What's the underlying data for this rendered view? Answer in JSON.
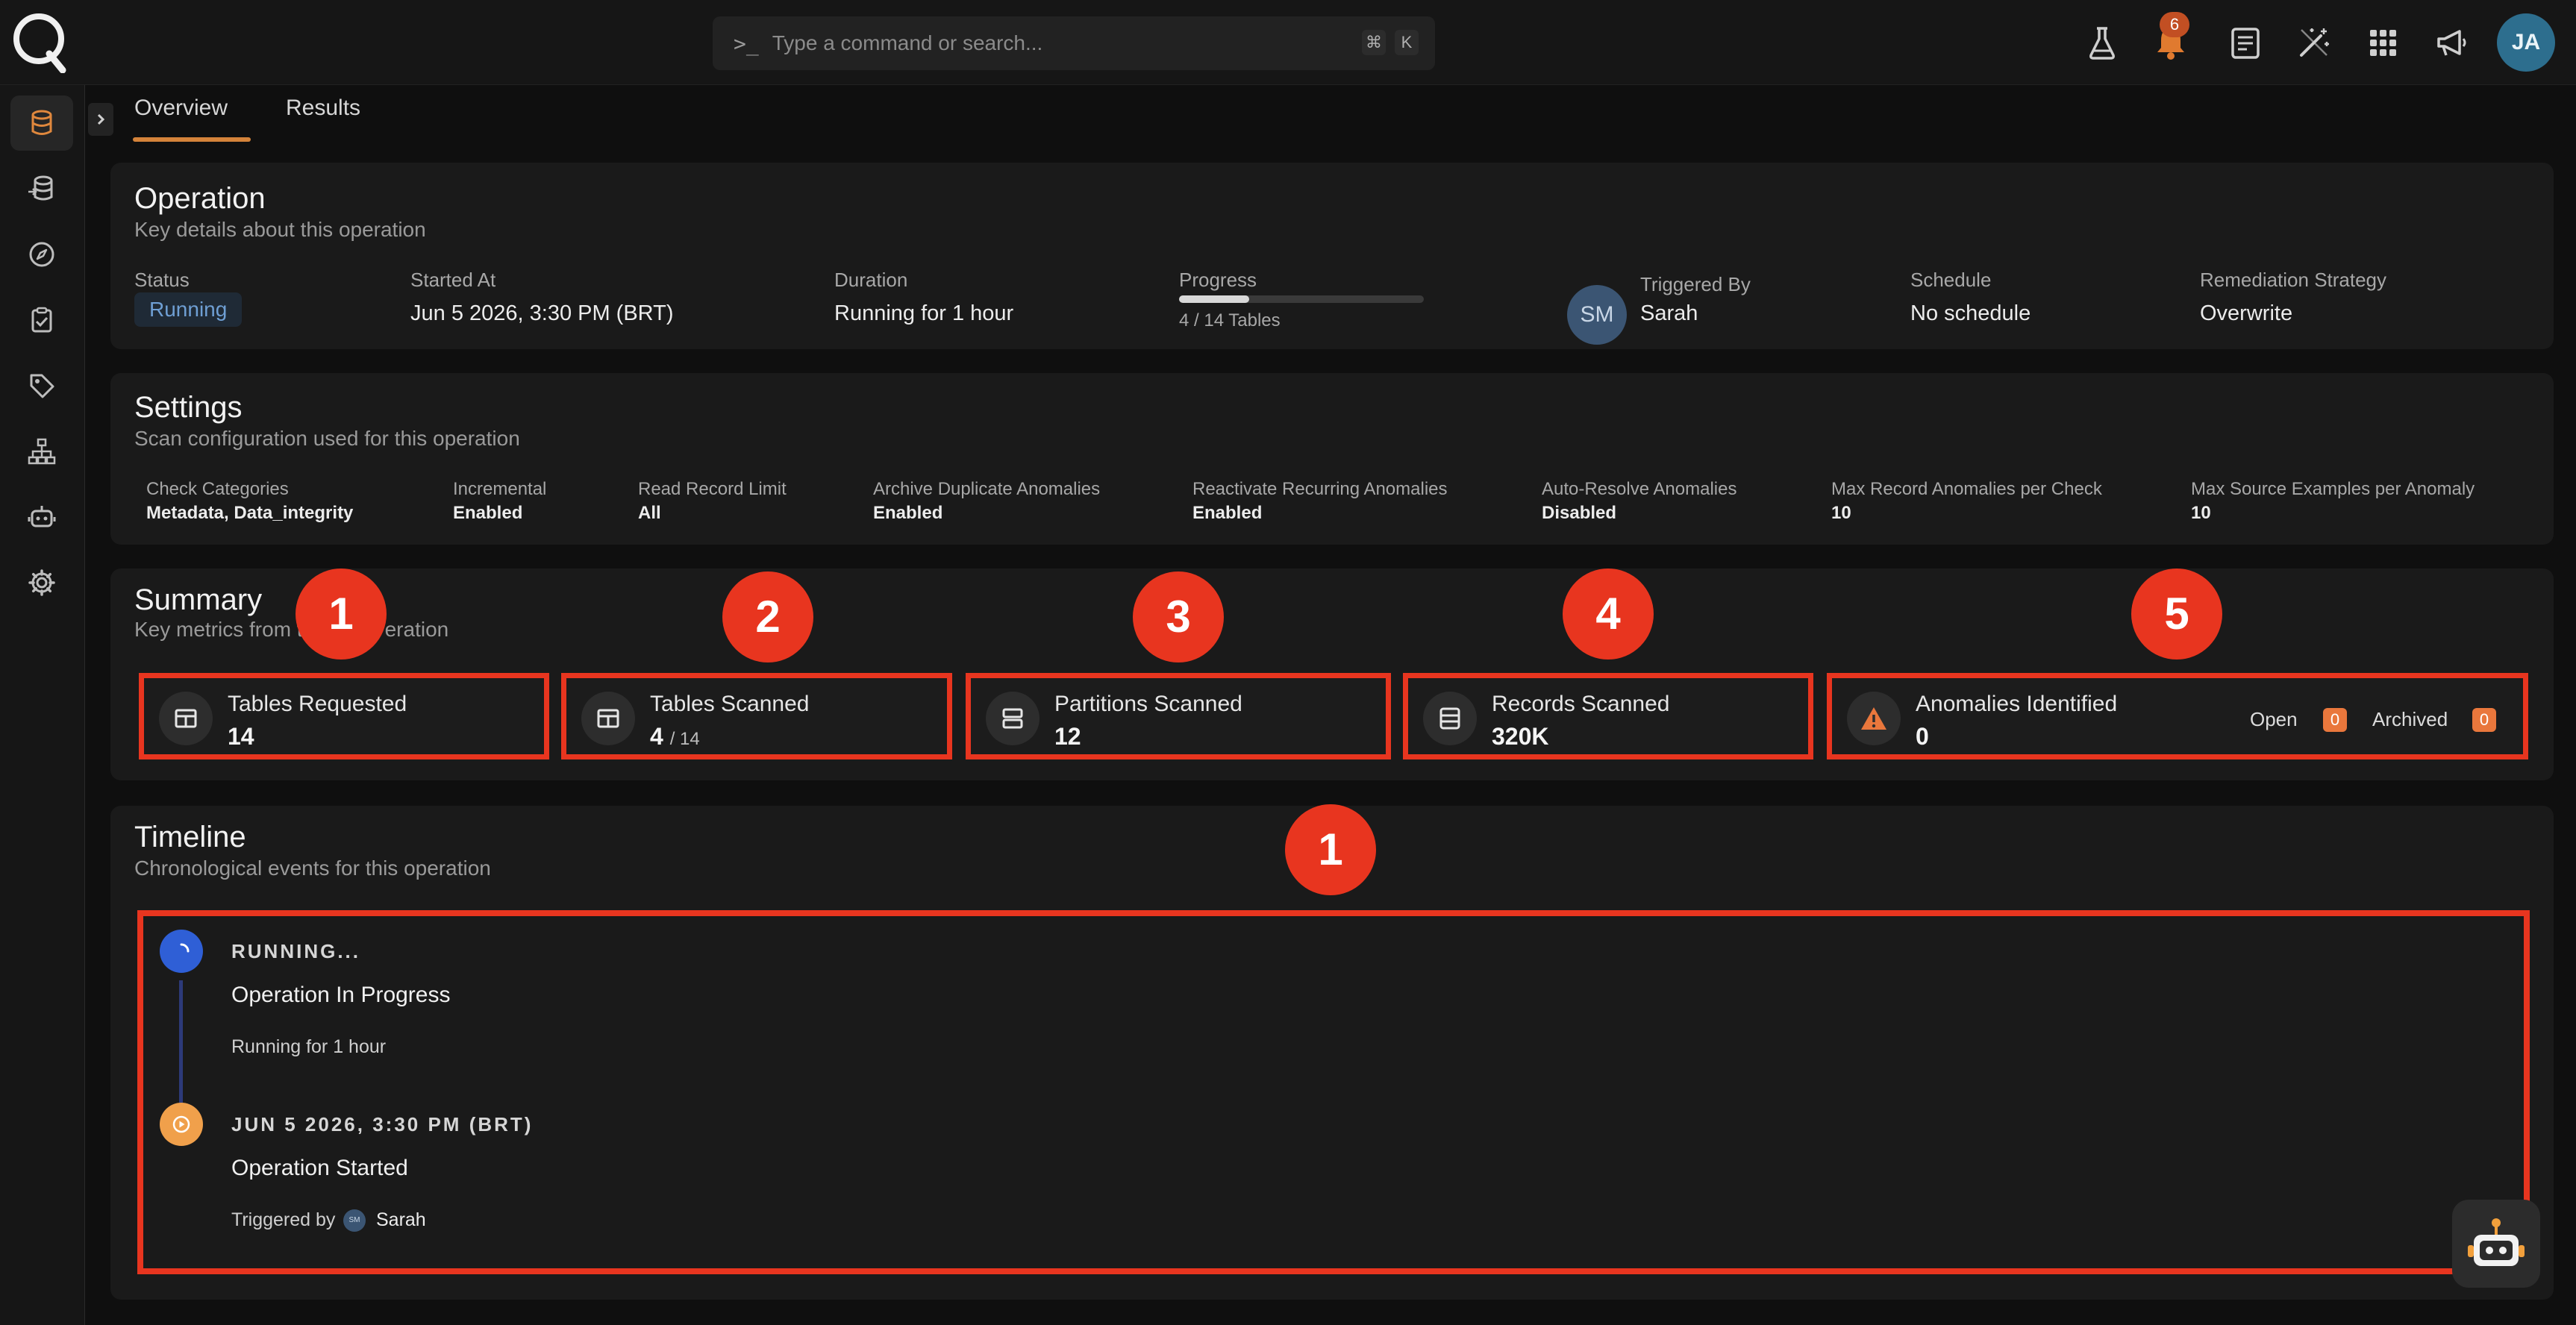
{
  "header": {
    "search_prompt": ">_",
    "search_placeholder": "Type a command or search...",
    "shortcut_key1": "⌘",
    "shortcut_key2": "K",
    "notification_count": "6",
    "user_initials": "JA"
  },
  "tabs": [
    {
      "label": "Overview",
      "active": true
    },
    {
      "label": "Results",
      "active": false
    }
  ],
  "operation": {
    "title": "Operation",
    "subtitle": "Key details about this operation",
    "status_label": "Status",
    "status_value": "Running",
    "started_label": "Started At",
    "started_value": "Jun 5 2026, 3:30 PM (BRT)",
    "duration_label": "Duration",
    "duration_value": "Running for 1 hour",
    "progress_label": "Progress",
    "progress_text": "4 / 14 Tables",
    "progress_fraction": 0.2857,
    "triggered_initials": "SM",
    "triggered_label": "Triggered By",
    "triggered_value": "Sarah",
    "schedule_label": "Schedule",
    "schedule_value": "No schedule",
    "remediation_label": "Remediation Strategy",
    "remediation_value": "Overwrite"
  },
  "settings": {
    "title": "Settings",
    "subtitle": "Scan configuration used for this operation",
    "items": [
      {
        "label": "Check Categories",
        "value": "Metadata, Data_integrity"
      },
      {
        "label": "Incremental",
        "value": "Enabled"
      },
      {
        "label": "Read Record Limit",
        "value": "All"
      },
      {
        "label": "Archive Duplicate Anomalies",
        "value": "Enabled"
      },
      {
        "label": "Reactivate Recurring Anomalies",
        "value": "Enabled"
      },
      {
        "label": "Auto-Resolve Anomalies",
        "value": "Disabled"
      },
      {
        "label": "Max Record Anomalies per Check",
        "value": "10"
      },
      {
        "label": "Max Source Examples per Anomaly",
        "value": "10"
      }
    ]
  },
  "summary": {
    "title": "Summary",
    "subtitle": "Key metrics from this operation",
    "subtitle_visible": "Key metrics from t",
    "subtitle_visible_end": "eration",
    "metrics": [
      {
        "label": "Tables Requested",
        "value": "14",
        "icon": "table-icon"
      },
      {
        "label": "Tables Scanned",
        "value": "4",
        "suffix": "/ 14",
        "icon": "table-icon"
      },
      {
        "label": "Partitions Scanned",
        "value": "12",
        "icon": "partition-icon"
      },
      {
        "label": "Records Scanned",
        "value": "320K",
        "icon": "records-icon"
      },
      {
        "label": "Anomalies Identified",
        "value": "0",
        "icon": "warning-icon"
      }
    ],
    "open_label": "Open",
    "open_count": "0",
    "archived_label": "Archived",
    "archived_count": "0"
  },
  "timeline": {
    "title": "Timeline",
    "subtitle": "Chronological events for this operation",
    "events": [
      {
        "caps": "RUNNING...",
        "title": "Operation In Progress",
        "meta": "Running for 1 hour"
      },
      {
        "caps": "JUN 5 2026, 3:30 PM (BRT)",
        "title": "Operation Started",
        "meta_prefix": "Triggered by",
        "avatar": "SM",
        "user": "Sarah"
      }
    ]
  },
  "callouts": [
    "1",
    "2",
    "3",
    "4",
    "5",
    "1"
  ],
  "colors": {
    "accent": "#d4833a",
    "highlight": "#e8351f",
    "running_dot": "#2f5fd6",
    "started_dot": "#f0a04b"
  }
}
